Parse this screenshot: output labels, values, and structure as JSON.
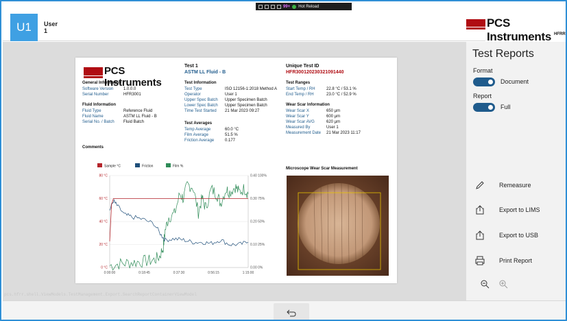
{
  "header": {
    "avatar_initials": "U1",
    "user_name": "User",
    "user_id": "1",
    "debug": {
      "count": "99+",
      "hot_reload": "Hot Reload"
    },
    "brand": {
      "name": "PCS Instruments",
      "product": "HFRR"
    }
  },
  "report": {
    "brand": "PCS Instruments",
    "test_title": "Test 1",
    "test_fluid": "ASTM LL Fluid - B",
    "unique_id_label": "Unique Test ID",
    "unique_id": "HFR300120230321091440",
    "general": {
      "heading": "General Information",
      "rows": [
        {
          "k": "Software Version",
          "v": "1.0.0.0"
        },
        {
          "k": "Serial Number",
          "v": "HFR3001"
        }
      ]
    },
    "fluid": {
      "heading": "Fluid Information",
      "rows": [
        {
          "k": "Fluid Type",
          "v": "Reference Fluid"
        },
        {
          "k": "Fluid Name",
          "v": "ASTM LL Fluid - B"
        },
        {
          "k": "Serial No. / Batch",
          "v": "Fluid Batch"
        }
      ]
    },
    "test_info": {
      "heading": "Test Information",
      "rows": [
        {
          "k": "Test Type",
          "v": "ISO 12156-1:2018 Method A"
        },
        {
          "k": "Operator",
          "v": "User 1"
        },
        {
          "k": "Upper Spec Batch",
          "v": "Upper Specimen Batch"
        },
        {
          "k": "Lower Spec Batch",
          "v": "Upper Specimen Batch"
        },
        {
          "k": "Time Test Started",
          "v": "21 Mar 2023 09:27"
        }
      ]
    },
    "averages": {
      "heading": "Test Averages",
      "rows": [
        {
          "k": "Temp Average",
          "v": "60.0 °C"
        },
        {
          "k": "Film Average",
          "v": "51.5 %"
        },
        {
          "k": "Friction Average",
          "v": "0.177"
        }
      ]
    },
    "ranges": {
      "heading": "Test Ranges",
      "rows": [
        {
          "k": "Start Temp / RH",
          "v": "22.8 °C / 53.1 %"
        },
        {
          "k": "End Temp / RH",
          "v": "23.0 °C / 52.9 %"
        }
      ]
    },
    "wear": {
      "heading": "Wear Scar Information",
      "rows": [
        {
          "k": "Wear Scar X",
          "v": "650 µm"
        },
        {
          "k": "Wear Scar Y",
          "v": "600 µm"
        },
        {
          "k": "Wear Scar AVG",
          "v": "620 µm"
        },
        {
          "k": "Measured By",
          "v": "User 1"
        },
        {
          "k": "Measurement Date",
          "v": "21 Mar 2023 11:17"
        }
      ]
    },
    "comments_heading": "Comments",
    "microscope_title": "Microscope Wear Scar Measurement"
  },
  "chart_data": {
    "type": "line",
    "legend": [
      "Sample °C",
      "Friction",
      "Film %"
    ],
    "colors": {
      "temp": "#b5252b",
      "friction": "#1f4f7a",
      "film": "#2e8b57"
    },
    "x_ticks": [
      "0:00:00",
      "0:18:45",
      "0:37:30",
      "0:56:15",
      "1:15:00"
    ],
    "y_left_ticks": [
      "0 °C",
      "20 °C",
      "40 °C",
      "60 °C",
      "80 °C"
    ],
    "y_right_ticks": [
      "0.00 0%",
      "0.10 25%",
      "0.20 50%",
      "0.30 75%",
      "0.40 100%"
    ],
    "xlim_minutes": [
      0,
      75
    ],
    "series": [
      {
        "name": "Sample °C",
        "axis": "left",
        "x": [
          0,
          1,
          2,
          75
        ],
        "y": [
          22.8,
          55,
          60,
          60
        ]
      },
      {
        "name": "Friction",
        "axis": "right",
        "x": [
          0,
          2,
          4,
          8,
          12,
          18,
          24,
          28,
          30,
          35,
          40,
          45,
          50,
          55,
          60,
          65,
          70,
          75
        ],
        "y": [
          0.25,
          0.29,
          0.27,
          0.23,
          0.22,
          0.21,
          0.19,
          0.14,
          0.12,
          0.125,
          0.12,
          0.11,
          0.11,
          0.105,
          0.12,
          0.1,
          0.1,
          0.11
        ]
      },
      {
        "name": "Film %",
        "axis": "right",
        "x": [
          0,
          5,
          10,
          15,
          20,
          24,
          27,
          29,
          30,
          32,
          35,
          38,
          40,
          42,
          45,
          48,
          50,
          52,
          55,
          58,
          60,
          63,
          65,
          68,
          70,
          73,
          75
        ],
        "y": [
          2,
          4,
          5,
          6,
          7,
          8,
          12,
          22,
          40,
          55,
          58,
          80,
          75,
          90,
          88,
          60,
          75,
          65,
          85,
          80,
          70,
          85,
          82,
          88,
          82,
          86,
          80
        ]
      }
    ]
  },
  "side_panel": {
    "title": "Test Reports",
    "format_label": "Format",
    "format_value": "Document",
    "report_label": "Report",
    "report_value": "Full",
    "actions": [
      {
        "label": "Remeasure",
        "icon": "pencil-icon"
      },
      {
        "label": "Export to LIMS",
        "icon": "export-icon"
      },
      {
        "label": "Export to USB",
        "icon": "export-icon"
      },
      {
        "label": "Print Report",
        "icon": "printer-icon"
      }
    ]
  },
  "status_path": "pcs.hfrr.shell.ViewModels.TestManagement.Export.SearchReportContainerViewModel"
}
